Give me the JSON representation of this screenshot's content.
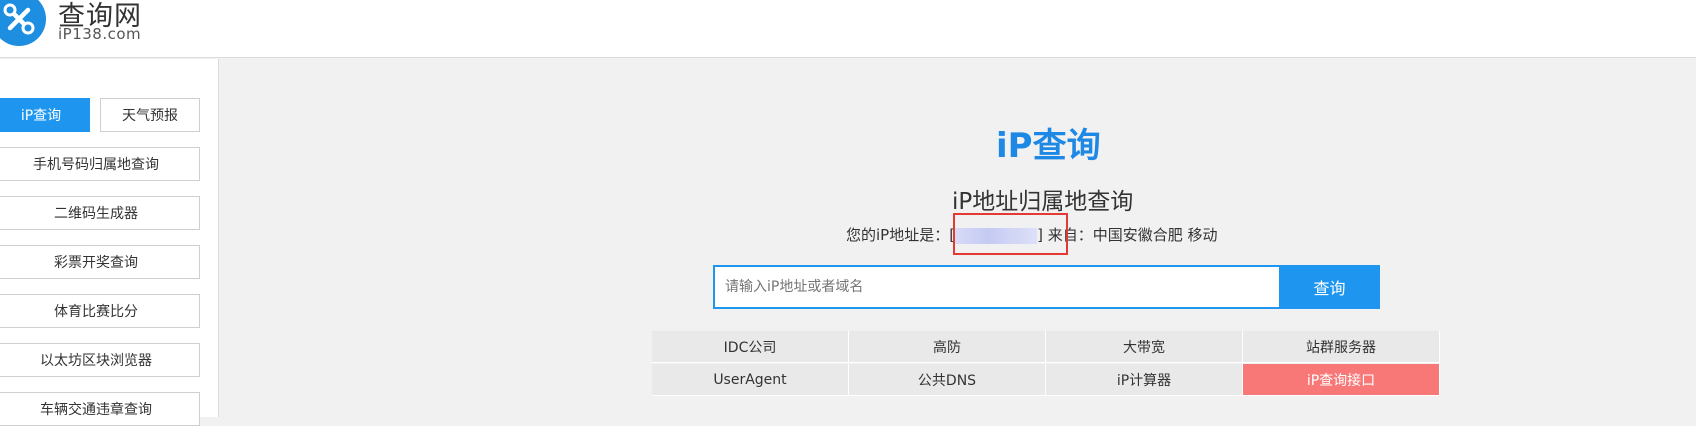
{
  "header": {
    "logo_icon": "wrench-screwdriver-icon",
    "title": "查询网",
    "subtitle": "iP138.com",
    "brand_color": "#1e8ee0"
  },
  "sidebar": {
    "items": [
      {
        "label": "iP查询",
        "active": true
      },
      {
        "label": "天气预报",
        "active": false
      },
      {
        "label": "手机号码归属地查询",
        "active": false
      },
      {
        "label": "二维码生成器",
        "active": false
      },
      {
        "label": "彩票开奖查询",
        "active": false
      },
      {
        "label": "体育比赛比分",
        "active": false
      },
      {
        "label": "以太坊区块浏览器",
        "active": false
      },
      {
        "label": "车辆交通违章查询",
        "active": false
      }
    ]
  },
  "main": {
    "heading": "iP查询",
    "subheading": "iP地址归属地查询",
    "ip_prefix": "您的iP地址是：[",
    "ip_suffix": "]",
    "from_label": "来自：",
    "location": "中国安徽合肥 移动",
    "search_placeholder": "请输入iP地址或者域名",
    "search_button": "查询",
    "accent_color": "#1e96f0",
    "highlight_color": "#e53935",
    "links": [
      {
        "label": "IDC公司"
      },
      {
        "label": "高防"
      },
      {
        "label": "大带宽"
      },
      {
        "label": "站群服务器"
      },
      {
        "label": "UserAgent"
      },
      {
        "label": "公共DNS"
      },
      {
        "label": "iP计算器"
      },
      {
        "label": "iP查询接口",
        "hot": true
      }
    ]
  }
}
